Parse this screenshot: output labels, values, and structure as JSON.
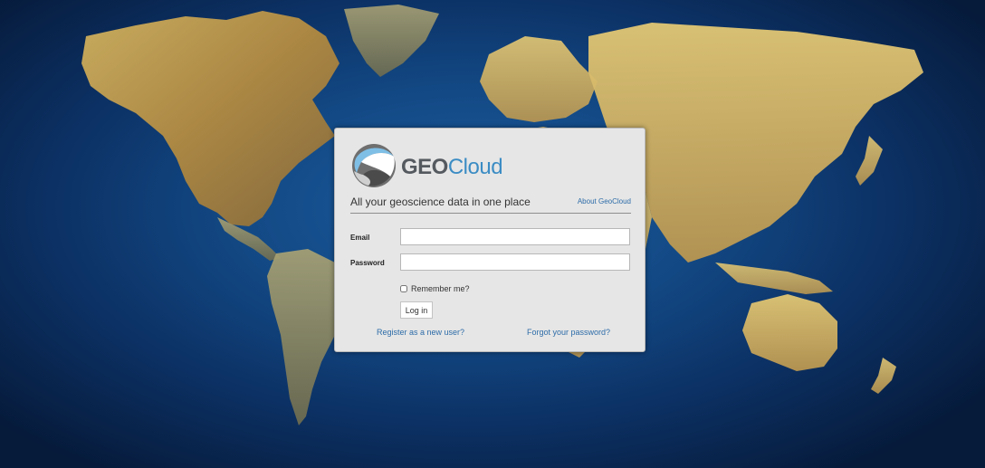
{
  "brand": {
    "name_bold": "GEO",
    "name_light": "Cloud",
    "tagline": "All your geoscience data in one place",
    "about_link": "About GeoCloud"
  },
  "form": {
    "email_label": "Email",
    "email_value": "",
    "password_label": "Password",
    "password_value": "",
    "remember_label": "Remember me?",
    "remember_checked": false,
    "login_button": "Log in",
    "register_link": "Register as a new user?",
    "forgot_link": "Forgot your password?"
  },
  "colors": {
    "accent_link": "#2d6ca8",
    "logo_cloud": "#3b8cc4",
    "panel_bg": "#e6e6e6",
    "ocean": "#134a86",
    "land": "#c9a24e"
  },
  "icons": {
    "logo": "globe-swirl-logo-icon"
  }
}
